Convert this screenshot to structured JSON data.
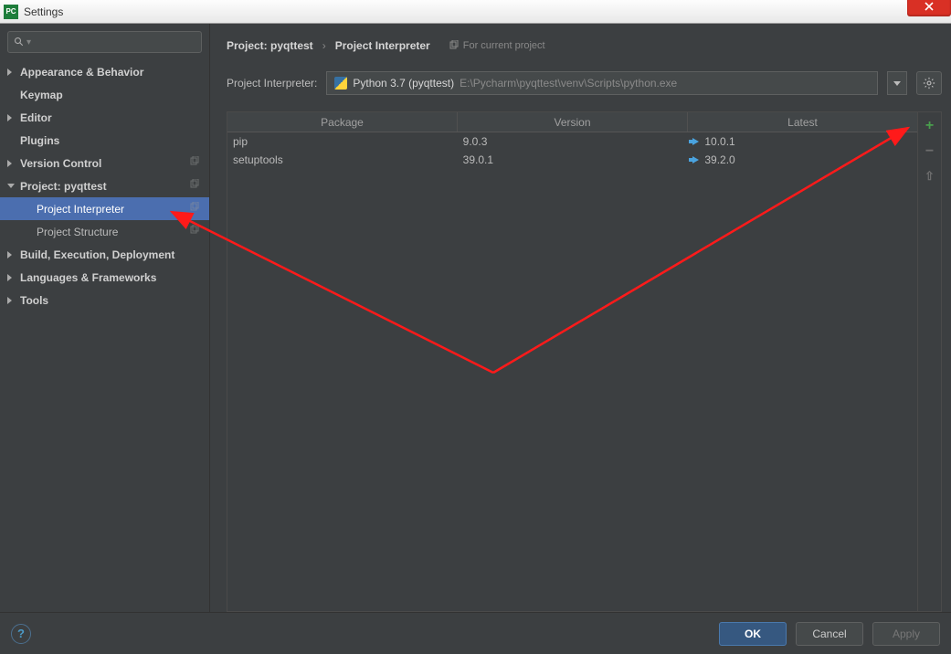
{
  "window": {
    "title": "Settings"
  },
  "sidebar": {
    "items": [
      {
        "label": "Appearance & Behavior",
        "bold": true,
        "arrow": "closed"
      },
      {
        "label": "Keymap",
        "bold": true
      },
      {
        "label": "Editor",
        "bold": true,
        "arrow": "closed"
      },
      {
        "label": "Plugins",
        "bold": true
      },
      {
        "label": "Version Control",
        "bold": true,
        "arrow": "closed",
        "copy": true
      },
      {
        "label": "Project: pyqttest",
        "bold": true,
        "arrow": "open",
        "copy": true
      },
      {
        "label": "Project Interpreter",
        "child": true,
        "copy": true,
        "selected": true
      },
      {
        "label": "Project Structure",
        "child": true,
        "copy": true
      },
      {
        "label": "Build, Execution, Deployment",
        "bold": true,
        "arrow": "closed"
      },
      {
        "label": "Languages & Frameworks",
        "bold": true,
        "arrow": "closed"
      },
      {
        "label": "Tools",
        "bold": true,
        "arrow": "closed"
      }
    ]
  },
  "breadcrumb": {
    "a": "Project: pyqttest",
    "b": "Project Interpreter",
    "hint": "For current project"
  },
  "interpreter": {
    "label": "Project Interpreter:",
    "name": "Python 3.7 (pyqttest)",
    "path": "E:\\Pycharm\\pyqttest\\venv\\Scripts\\python.exe"
  },
  "table": {
    "columns": [
      "Package",
      "Version",
      "Latest"
    ],
    "rows": [
      {
        "package": "pip",
        "version": "9.0.3",
        "latest": "10.0.1",
        "upgrade": true
      },
      {
        "package": "setuptools",
        "version": "39.0.1",
        "latest": "39.2.0",
        "upgrade": true
      }
    ]
  },
  "footer": {
    "ok": "OK",
    "cancel": "Cancel",
    "apply": "Apply"
  }
}
